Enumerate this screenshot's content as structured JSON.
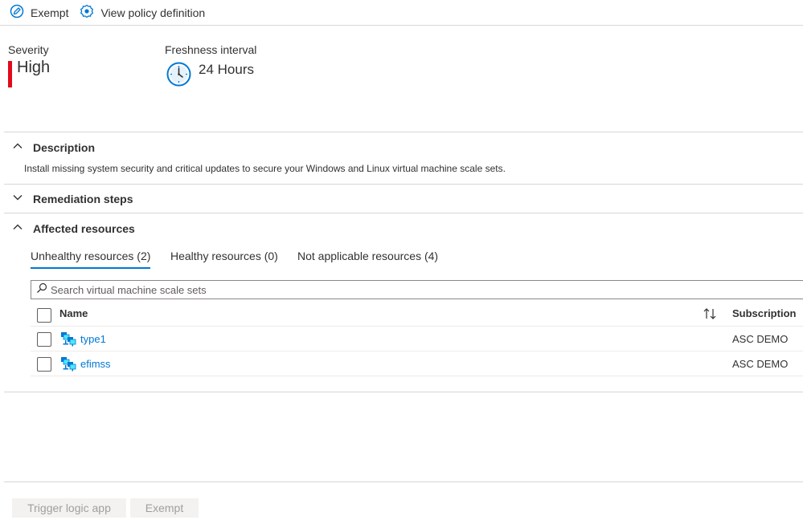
{
  "toolbar": {
    "exempt_label": "Exempt",
    "view_policy_label": "View policy definition"
  },
  "severity": {
    "label": "Severity",
    "value": "High",
    "color": "#e00b1c"
  },
  "freshness": {
    "label": "Freshness interval",
    "value": "24 Hours"
  },
  "sections": {
    "description": {
      "title": "Description",
      "expanded": true,
      "text": "Install missing system security and critical updates to secure your Windows and Linux virtual machine scale sets."
    },
    "remediation": {
      "title": "Remediation steps",
      "expanded": false
    },
    "affected": {
      "title": "Affected resources",
      "expanded": true
    }
  },
  "tabs": [
    {
      "label": "Unhealthy resources (2)",
      "selected": true
    },
    {
      "label": "Healthy resources (0)",
      "selected": false
    },
    {
      "label": "Not applicable resources (4)",
      "selected": false
    }
  ],
  "search": {
    "placeholder": "Search virtual machine scale sets"
  },
  "table": {
    "columns": {
      "name": "Name",
      "subscription": "Subscription"
    },
    "rows": [
      {
        "name": "type1",
        "subscription": "ASC DEMO",
        "icon": "vmss-icon"
      },
      {
        "name": "efimss",
        "subscription": "ASC DEMO",
        "icon": "vmss-icon"
      }
    ]
  },
  "footer": {
    "trigger_label": "Trigger logic app",
    "exempt_label": "Exempt"
  },
  "colors": {
    "accent": "#0078d4",
    "severity_high": "#e00b1c",
    "disabled_bg": "#f3f2f1",
    "disabled_text": "#a19f9d"
  }
}
